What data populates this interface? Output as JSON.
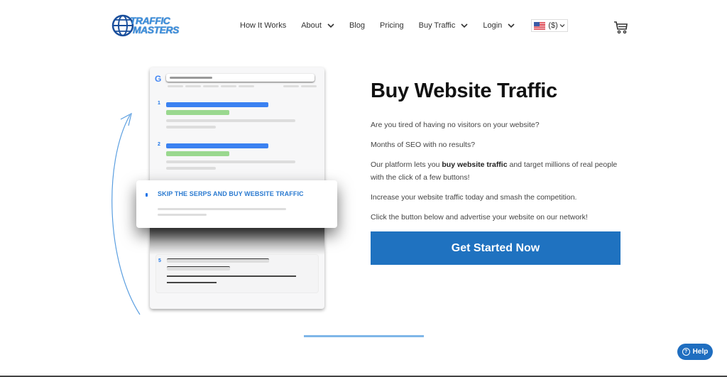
{
  "header": {
    "logo": {
      "line1": "TRAFFIC",
      "line2": "MASTERS"
    },
    "nav": [
      {
        "label": "How It Works",
        "has_dropdown": false
      },
      {
        "label": "About",
        "has_dropdown": true
      },
      {
        "label": "Blog",
        "has_dropdown": false
      },
      {
        "label": "Pricing",
        "has_dropdown": false
      },
      {
        "label": "Buy Traffic",
        "has_dropdown": true
      },
      {
        "label": "Login",
        "has_dropdown": true
      }
    ],
    "currency": {
      "flag": "us-flag",
      "label": "($)"
    },
    "cart_icon": "shopping-cart-icon"
  },
  "illustration": {
    "search_logo": "G",
    "results": [
      {
        "num": "1"
      },
      {
        "num": "2"
      },
      {
        "num": "5"
      }
    ],
    "card": {
      "title": "SKIP THE SERPS AND BUY WEBSITE TRAFFIC"
    }
  },
  "hero": {
    "title": "Buy Website Traffic",
    "p1": "Are you tired of having no visitors on your website?",
    "p2": "Months of SEO with no results?",
    "p3_before": "Our platform lets you ",
    "p3_bold": "buy website traffic",
    "p3_after": " and target millions of real people with the click of a few buttons!",
    "p4": "Increase your website traffic today and smash the competition.",
    "p5": "Click the button below and advertise your website on our network!",
    "cta_label": "Get Started Now"
  },
  "help": {
    "label": "Help",
    "icon": "?"
  },
  "colors": {
    "accent": "#1f72c0",
    "divider": "#7fb6e8",
    "result_blue": "#3b82f1",
    "result_green": "#9ad88f"
  }
}
